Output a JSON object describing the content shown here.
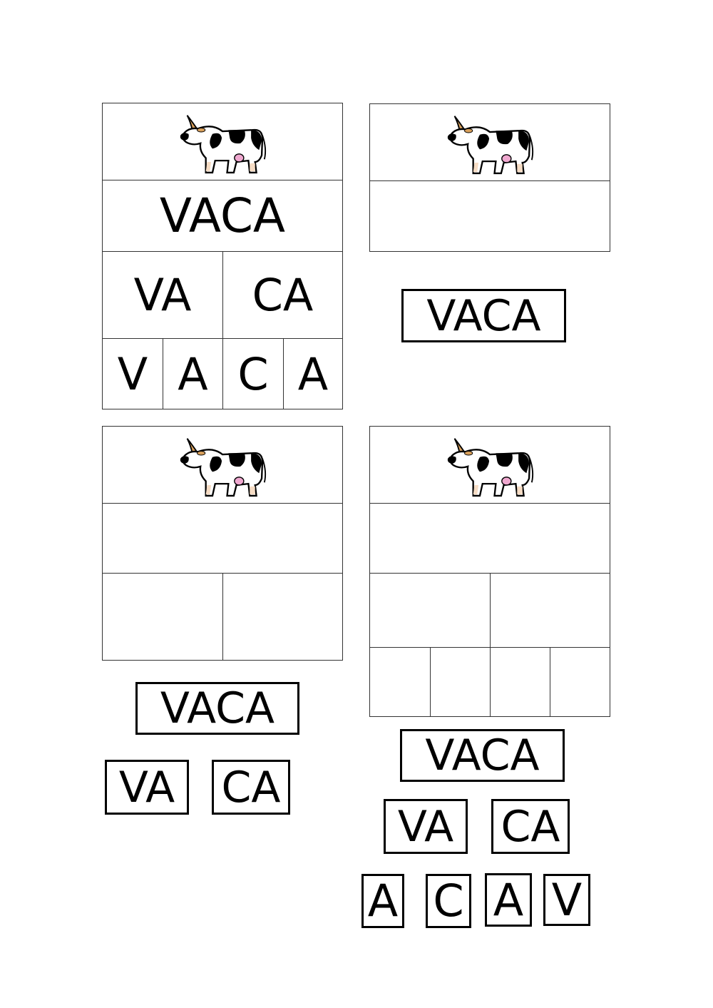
{
  "word": "VACA",
  "syllables": [
    "VA",
    "CA"
  ],
  "letters": [
    "V",
    "A",
    "C",
    "A"
  ],
  "card_image": "cow-picture",
  "tiles": {
    "card2": [
      "VACA"
    ],
    "card3": [
      "VACA",
      "VA",
      "CA"
    ],
    "card4": [
      "VACA",
      "VA",
      "CA",
      "A",
      "C",
      "A",
      "V"
    ]
  },
  "colors": {
    "horn": "#d9a05b",
    "udder": "#f0a8d0",
    "hoof": "#f6dcc4"
  }
}
